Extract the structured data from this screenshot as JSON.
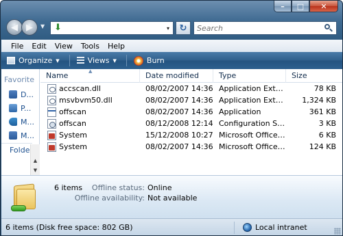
{
  "window": {
    "caption_min": "–",
    "caption_max": "□",
    "caption_close": "✕"
  },
  "address_bar": {
    "path_value": "",
    "dropdown_glyph": "▾"
  },
  "search": {
    "placeholder": "Search"
  },
  "menu": {
    "items": [
      "File",
      "Edit",
      "View",
      "Tools",
      "Help"
    ]
  },
  "toolbar": {
    "organize": "Organize",
    "views": "Views",
    "burn": "Burn"
  },
  "nav_pane": {
    "favorites_heading": "Favorite",
    "favorites": [
      {
        "label": "D...",
        "icon": "documents-icon"
      },
      {
        "label": "P...",
        "icon": "pictures-icon"
      },
      {
        "label": "M...",
        "icon": "music-icon"
      },
      {
        "label": "M...",
        "icon": "more-icon"
      }
    ],
    "folders_label": "Folders"
  },
  "columns": [
    "Name",
    "Date modified",
    "Type",
    "Size"
  ],
  "files": [
    {
      "name": "accscan.dll",
      "date": "08/02/2007 14:36",
      "type": "Application Extens...",
      "size": "78 KB",
      "icon": "dll-file-icon"
    },
    {
      "name": "msvbvm50.dll",
      "date": "08/02/2007 14:36",
      "type": "Application Extens...",
      "size": "1,324 KB",
      "icon": "dll-file-icon"
    },
    {
      "name": "offscan",
      "date": "08/02/2007 14:36",
      "type": "Application",
      "size": "361 KB",
      "icon": "application-file-icon"
    },
    {
      "name": "offscan",
      "date": "08/12/2008 12:14",
      "type": "Configuration Sett...",
      "size": "3 KB",
      "icon": "config-file-icon"
    },
    {
      "name": "System",
      "date": "15/12/2008 10:27",
      "type": "Microsoft Office A...",
      "size": "6 KB",
      "icon": "office-file-icon"
    },
    {
      "name": "System",
      "date": "08/02/2007 14:36",
      "type": "Microsoft Office A...",
      "size": "124 KB",
      "icon": "office-file-icon"
    }
  ],
  "details": {
    "items_count": "6 items",
    "offline_status_label": "Offline status:",
    "offline_status_value": "Online",
    "offline_availability_label": "Offline availability:",
    "offline_availability_value": "Not available"
  },
  "statusbar": {
    "left_text": "6 items (Disk free space: 802 GB)",
    "zone_text": "Local intranet"
  },
  "colors": {
    "toolbar_blue": "#2f5f8b",
    "link_blue": "#1c4f8e",
    "details_bg": "#dbe8f4"
  }
}
